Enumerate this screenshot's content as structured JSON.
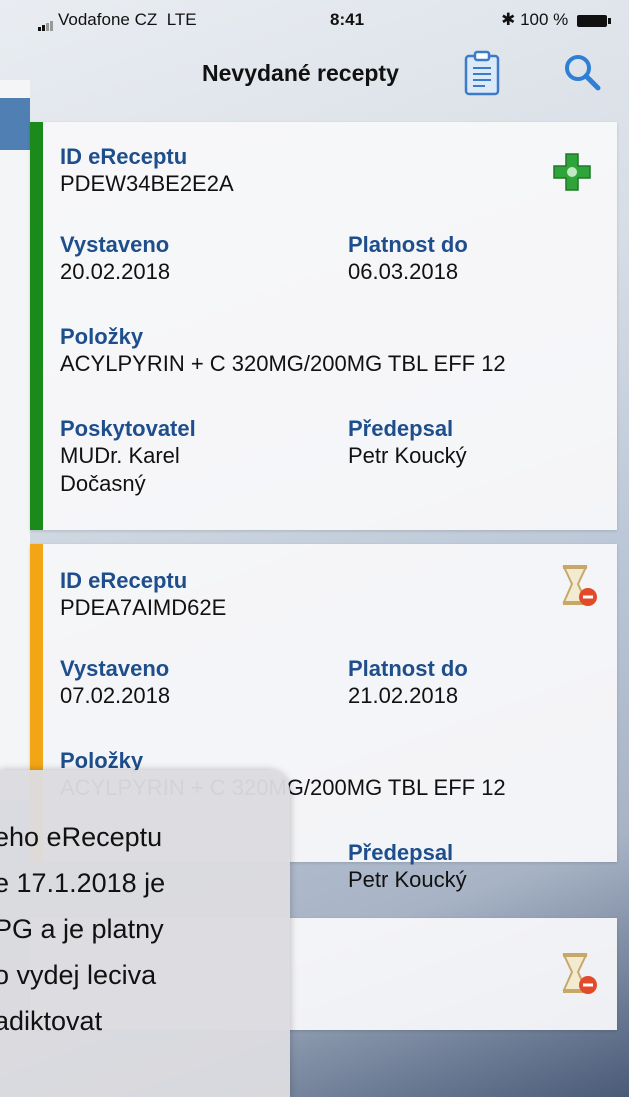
{
  "status_bar": {
    "carrier": "Vodafone CZ",
    "network": "LTE",
    "time": "8:41",
    "battery_text": "100 %"
  },
  "nav": {
    "title": "Nevydané recepty",
    "clipboard_icon": "clipboard-icon",
    "search_icon": "search-icon"
  },
  "cards": [
    {
      "stripe_color": "#1a8a1a",
      "status_icon": "pharmacy-cross-icon",
      "id_label": "ID eReceptu",
      "id_value": "PDEW34BE2E2A",
      "issued_label": "Vystaveno",
      "issued_value": "20.02.2018",
      "valid_label": "Platnost do",
      "valid_value": "06.03.2018",
      "items_label": "Položky",
      "items_value": "ACYLPYRIN + C 320MG/200MG TBL EFF 12",
      "provider_label": "Poskytovatel",
      "provider_value_1": "MUDr. Karel",
      "provider_value_2": "Dočasný",
      "prescriber_label": "Předepsal",
      "prescriber_value": "Petr Koucký"
    },
    {
      "stripe_color": "#f2a515",
      "status_icon": "hourglass-expired-icon",
      "id_label": "ID eReceptu",
      "id_value": "PDEA7AIMD62E",
      "issued_label": "Vystaveno",
      "issued_value": "07.02.2018",
      "valid_label": "Platnost do",
      "valid_value": "21.02.2018",
      "items_label": "Položky",
      "items_value": "ACYLPYRIN + C 320MG/200MG TBL EFF 12",
      "prescriber_label": "Předepsal",
      "prescriber_value": "Petr Koucký"
    },
    {
      "status_icon": "hourglass-expired-icon"
    }
  ],
  "notification": {
    "lines": [
      "eho eReceptu",
      "e 17.1.2018 je",
      "PG a je platny",
      "o vydej leciva",
      "adiktovat"
    ]
  }
}
